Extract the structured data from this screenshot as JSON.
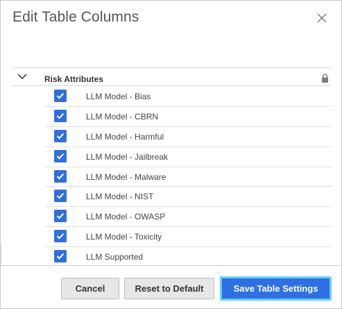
{
  "dialog": {
    "title": "Edit Table Columns",
    "close_icon": "close-icon"
  },
  "group": {
    "label": "Risk Attributes",
    "expanded": true,
    "toggle_icon": "chevron-down-icon",
    "lock_icon": "lock-icon"
  },
  "columns": [
    {
      "label": "LLM Model - Bias",
      "checked": true
    },
    {
      "label": "LLM Model - CBRN",
      "checked": true
    },
    {
      "label": "LLM Model - Harmful",
      "checked": true
    },
    {
      "label": "LLM Model - Jailbreak",
      "checked": true
    },
    {
      "label": "LLM Model - Malware",
      "checked": true
    },
    {
      "label": "LLM Model - NIST",
      "checked": true
    },
    {
      "label": "LLM Model - OWASP",
      "checked": true
    },
    {
      "label": "LLM Model - Toxicity",
      "checked": true
    },
    {
      "label": "LLM Supported",
      "checked": true
    }
  ],
  "footer": {
    "cancel_label": "Cancel",
    "reset_label": "Reset to Default",
    "save_label": "Save Table Settings"
  },
  "colors": {
    "accent": "#2e6fe5",
    "focus_ring": "#5fd2f2",
    "checkbox": "#2f6fe0"
  }
}
